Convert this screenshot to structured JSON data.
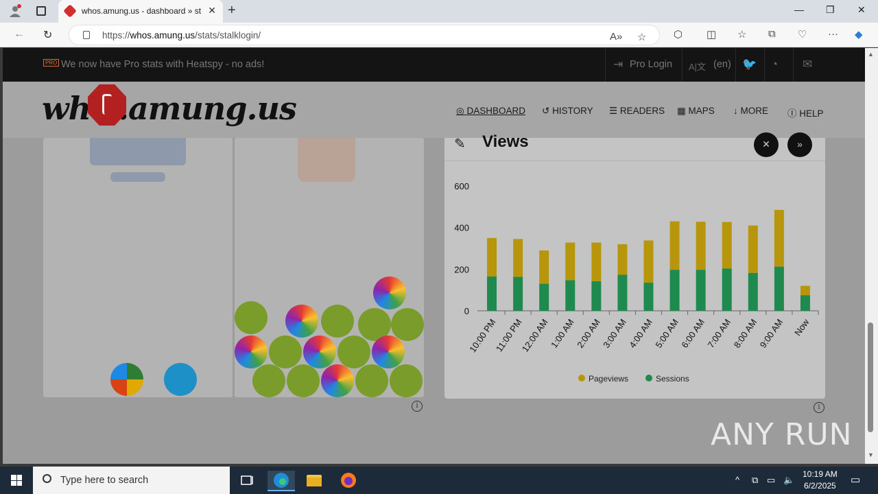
{
  "browser": {
    "tab_title": "whos.amung.us - dashboard » st",
    "url_prefix": "https://",
    "url_host": "whos.amung.us",
    "url_path": "/stats/stalklogin/"
  },
  "topbar": {
    "pro_badge": "PRO",
    "announcement": "We now have Pro stats with Heatspy - no ads!",
    "pro_login": "Pro Login",
    "language": "(en)"
  },
  "header": {
    "logo_text": "wh  s.amung.us",
    "nav": [
      "DASHBOARD",
      "HISTORY",
      "READERS",
      "MAPS",
      "MORE",
      "HELP"
    ]
  },
  "chart_card": {
    "title": "Views"
  },
  "chart_data": {
    "type": "bar",
    "stacked": true,
    "categories": [
      "10:00 PM",
      "11:00 PM",
      "12:00 AM",
      "1:00 AM",
      "2:00 AM",
      "3:00 AM",
      "4:00 AM",
      "5:00 AM",
      "6:00 AM",
      "7:00 AM",
      "8:00 AM",
      "9:00 AM",
      "Now"
    ],
    "series": [
      {
        "name": "Sessions",
        "color": "#1e8a4e",
        "values": [
          165,
          163,
          130,
          147,
          142,
          173,
          135,
          197,
          197,
          203,
          182,
          212,
          75
        ]
      },
      {
        "name": "Pageviews",
        "color": "#b8960c",
        "values": [
          350,
          345,
          290,
          328,
          328,
          320,
          338,
          430,
          428,
          427,
          410,
          485,
          120
        ]
      }
    ],
    "yticks": [
      0,
      200,
      400,
      600
    ],
    "ylim": [
      0,
      600
    ],
    "legend": "bottom-center"
  },
  "taskbar": {
    "search_placeholder": "Type here to search",
    "time": "10:19 AM",
    "date": "6/2/2025"
  },
  "watermark": "ANY RUN"
}
